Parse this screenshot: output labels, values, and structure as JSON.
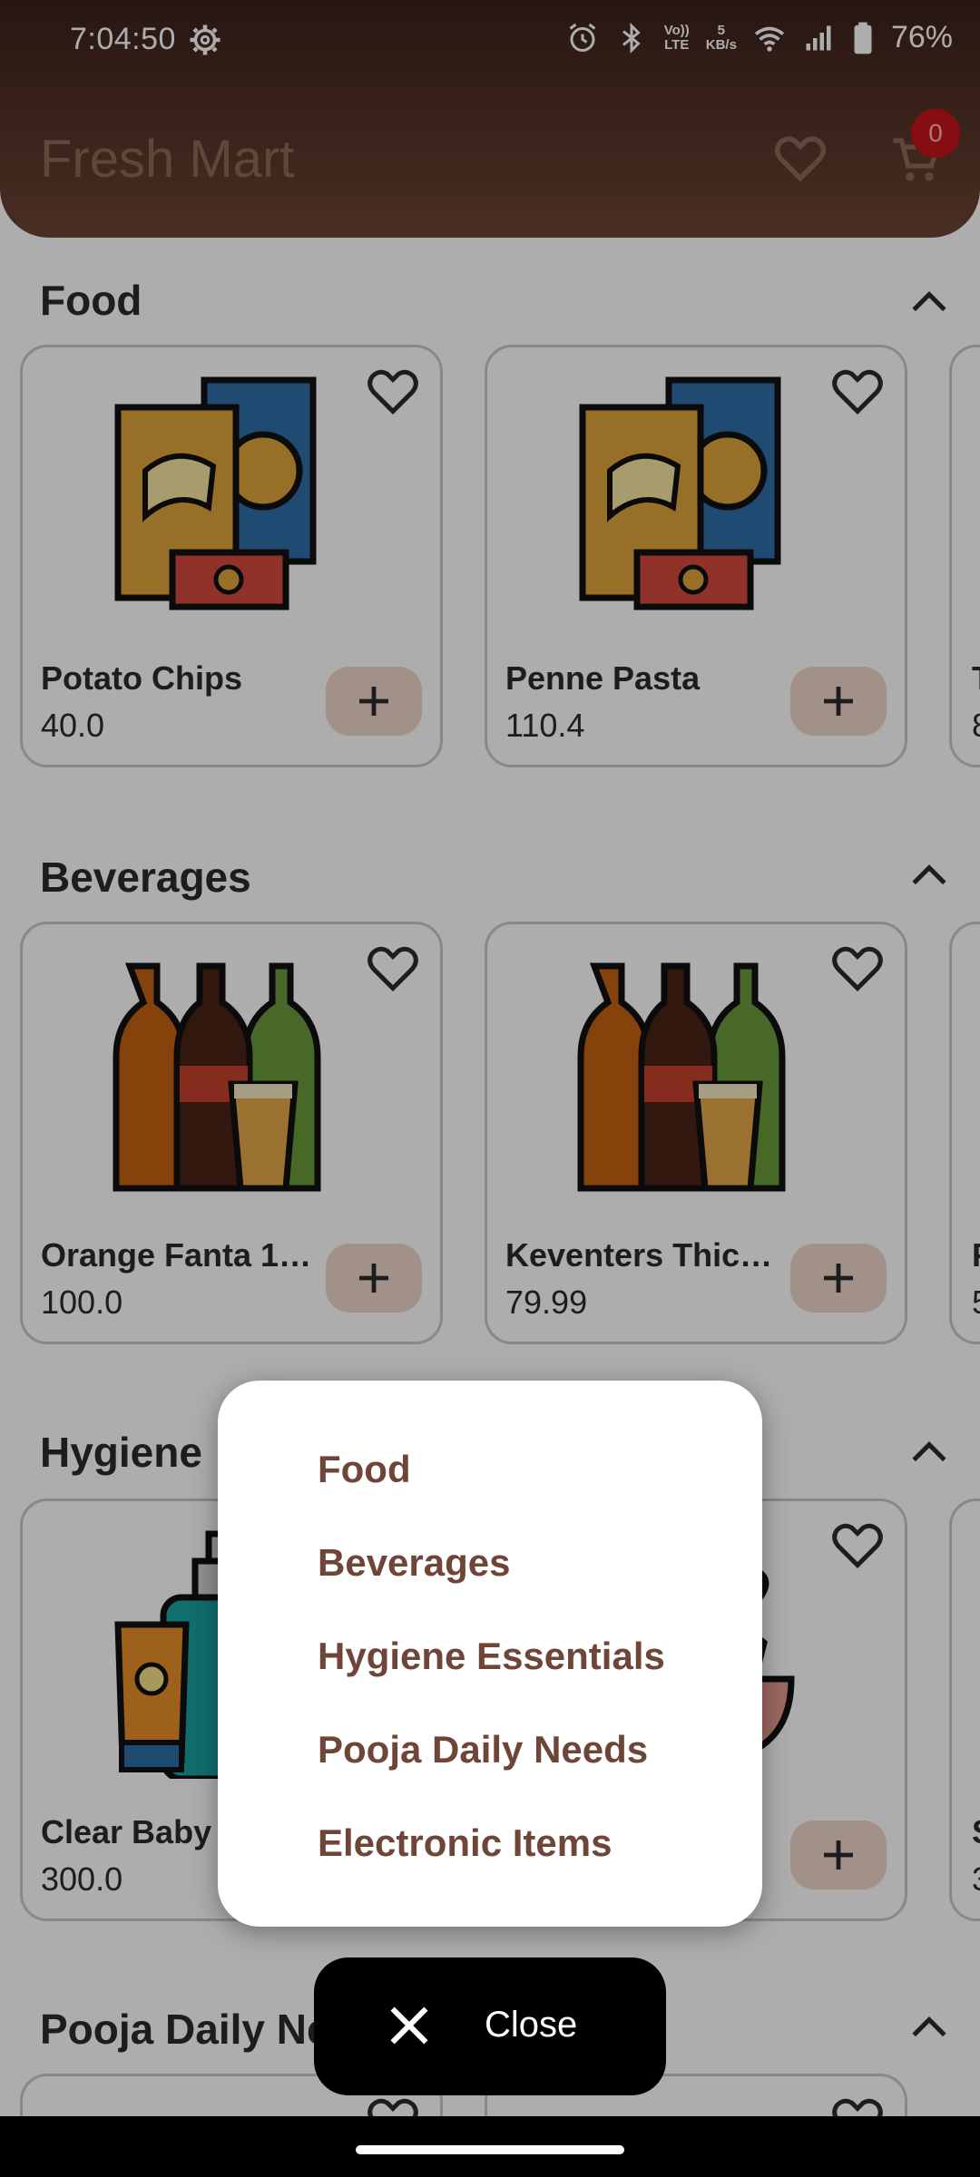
{
  "status_bar": {
    "time": "7:04:50",
    "network_speed_value": "5",
    "network_speed_unit": "KB/s",
    "volte_top": "Vo))",
    "volte_bottom": "LTE",
    "battery": "76%"
  },
  "header": {
    "title": "Fresh Mart",
    "cart_count": "0"
  },
  "sections": [
    {
      "title": "Food",
      "products": [
        {
          "name": "Potato Chips",
          "price": "40.0"
        },
        {
          "name": "Penne Pasta",
          "price": "110.4"
        }
      ],
      "partial": {
        "name": "T",
        "price": "8"
      }
    },
    {
      "title": "Beverages",
      "products": [
        {
          "name": "Orange Fanta 1 ...",
          "price": "100.0"
        },
        {
          "name": "Keventers Thick...",
          "price": "79.99"
        }
      ],
      "partial": {
        "name": "F",
        "price": "5"
      }
    },
    {
      "title": "Hygiene",
      "products": [
        {
          "name": "Clear Baby",
          "price": "300.0"
        },
        {
          "name": "",
          "price": ""
        }
      ],
      "partial": {
        "name": "S",
        "price": "3"
      }
    },
    {
      "title": "Pooja Daily Ne"
    }
  ],
  "menu": {
    "items": [
      "Food",
      "Beverages",
      "Hygiene Essentials",
      "Pooja Daily Needs",
      "Electronic Items"
    ]
  },
  "close_button": {
    "label": "Close"
  },
  "colors": {
    "brand_dark": "#3b2119",
    "accent_text": "#6e4537",
    "add_button_bg": "#efd6cb",
    "badge_red": "#c6141a"
  }
}
